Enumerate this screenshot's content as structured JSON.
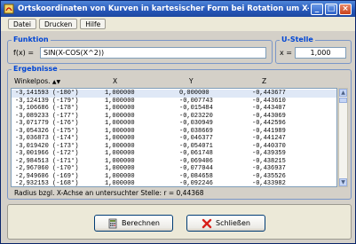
{
  "window": {
    "title": "Ortskoordinaten von Kurven in kartesischer Form bei Rotation um X-Achse",
    "minimize": "_",
    "maximize": "□",
    "close": "×"
  },
  "menu": [
    {
      "label": "Datei"
    },
    {
      "label": "Drucken"
    },
    {
      "label": "Hilfe"
    }
  ],
  "funktion": {
    "title": "Funktion",
    "label": "f(x) =",
    "value": "SIN(X-COS(X^2))"
  },
  "ustelle": {
    "title": "U-Stelle",
    "label": "x =",
    "value": "1,000"
  },
  "ergebnisse": {
    "title": "Ergebnisse",
    "columns": [
      "Winkelpos.",
      "X",
      "Y",
      "Z"
    ],
    "sort_marker": "▲▼",
    "rows": [
      [
        "-3,141593 (-180°)",
        "1,000000",
        "0,000000",
        "-0,443677"
      ],
      [
        "-3,124139 (-179°)",
        "1,000000",
        "-0,007743",
        "-0,443610"
      ],
      [
        "-3,106686 (-178°)",
        "1,000000",
        "-0,015484",
        "-0,443407"
      ],
      [
        "-3,089233 (-177°)",
        "1,000000",
        "-0,023220",
        "-0,443069"
      ],
      [
        "-3,071779 (-176°)",
        "1,000000",
        "-0,030949",
        "-0,442596"
      ],
      [
        "-3,054326 (-175°)",
        "1,000000",
        "-0,038669",
        "-0,441989"
      ],
      [
        "-3,036873 (-174°)",
        "1,000000",
        "-0,046377",
        "-0,441247"
      ],
      [
        "-3,019420 (-173°)",
        "1,000000",
        "-0,054071",
        "-0,440370"
      ],
      [
        "-3,001966 (-172°)",
        "1,000000",
        "-0,061748",
        "-0,439359"
      ],
      [
        "-2,984513 (-171°)",
        "1,000000",
        "-0,069406",
        "-0,438215"
      ],
      [
        "-2,967060 (-170°)",
        "1,000000",
        "-0,077044",
        "-0,436937"
      ],
      [
        "-2,949606 (-169°)",
        "1,000000",
        "-0,084658",
        "-0,435526"
      ],
      [
        "-2,932153 (-168°)",
        "1,000000",
        "-0,092246",
        "-0,433982"
      ]
    ],
    "footer": "Radius bzgl. X-Achse an untersuchter Stelle: r = 0,44368"
  },
  "buttons": {
    "berechnen": "Berechnen",
    "schliessen": "Schließen"
  },
  "colors": {
    "title_blue": "#2656b8",
    "group_title": "#0046d5",
    "close_red": "#c8401a"
  },
  "icons": {
    "app": "app-icon",
    "calculate": "calculator-icon",
    "close": "red-x-icon"
  }
}
